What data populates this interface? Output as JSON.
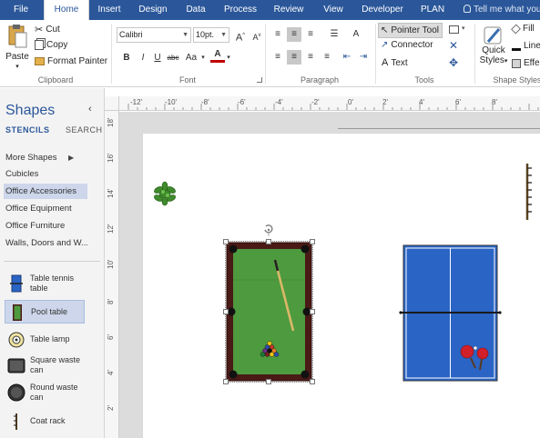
{
  "ribbon_tabs": [
    {
      "label": "File"
    },
    {
      "label": "Home"
    },
    {
      "label": "Insert"
    },
    {
      "label": "Design"
    },
    {
      "label": "Data"
    },
    {
      "label": "Process"
    },
    {
      "label": "Review"
    },
    {
      "label": "View"
    },
    {
      "label": "Developer"
    },
    {
      "label": "PLAN"
    }
  ],
  "tell_me": "Tell me what you",
  "clipboard": {
    "paste": "Paste",
    "cut": "Cut",
    "copy": "Copy",
    "format_painter": "Format Painter",
    "label": "Clipboard"
  },
  "font": {
    "family": "Calibri",
    "size": "10pt.",
    "bold": "B",
    "italic": "I",
    "underline": "U",
    "strike": "abc",
    "case": "Aa",
    "grow": "A",
    "shrink": "A",
    "color_glyph": "A",
    "label": "Font"
  },
  "paragraph": {
    "label": "Paragraph"
  },
  "tools": {
    "pointer": "Pointer Tool",
    "connector": "Connector",
    "text": "Text",
    "label": "Tools"
  },
  "shape_styles": {
    "quick_styles_1": "Quick",
    "quick_styles_2": "Styles",
    "fill": "Fill",
    "line": "Line",
    "effects": "Effe",
    "label": "Shape Styles"
  },
  "shapes_pane": {
    "title": "Shapes",
    "tab_stencils": "STENCILS",
    "tab_search": "SEARCH",
    "stencils": [
      {
        "label": "More Shapes"
      },
      {
        "label": "Cubicles"
      },
      {
        "label": "Office Accessories"
      },
      {
        "label": "Office Equipment"
      },
      {
        "label": "Office Furniture"
      },
      {
        "label": "Walls, Doors and W..."
      }
    ],
    "masters": [
      {
        "label": "Table tennis table"
      },
      {
        "label": "Pool table"
      },
      {
        "label": "Table lamp"
      },
      {
        "label": "Square waste can"
      },
      {
        "label": "Round waste can"
      },
      {
        "label": "Coat rack"
      }
    ]
  },
  "ruler": {
    "h_labels": [
      "-12'",
      "-10'",
      "-8'",
      "-6'",
      "-4'",
      "-2'",
      "0'",
      "2'",
      "4'",
      "6'",
      "8'"
    ],
    "v_labels": [
      "18'",
      "16'",
      "14'",
      "12'",
      "10'",
      "8'",
      "6'",
      "4'",
      "2'"
    ]
  },
  "colors": {
    "accent": "#2b579a",
    "selection": "#cdd6ea",
    "felt": "#4e9a3f",
    "table_tennis": "#2a64c4",
    "pool_rail": "#5a1f1a"
  },
  "icons": [
    "paste-icon",
    "cut-icon",
    "copy-icon",
    "format-painter-icon",
    "pointer-icon",
    "connector-icon",
    "text-icon",
    "quick-styles-icon"
  ]
}
